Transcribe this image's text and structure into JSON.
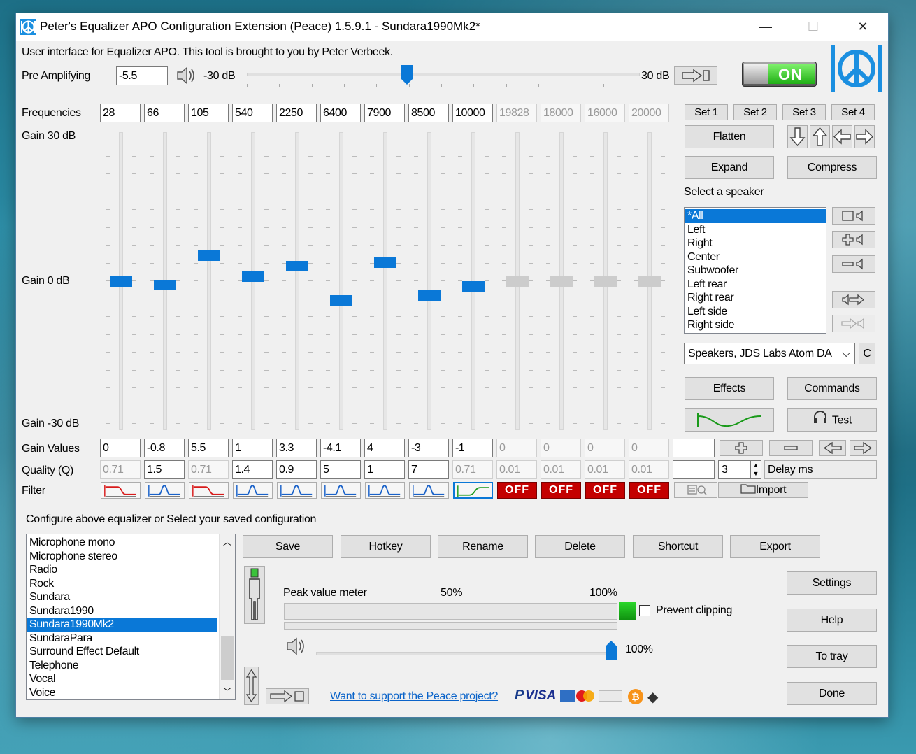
{
  "window": {
    "title": "Peter's Equalizer APO Configuration Extension (Peace) 1.5.9.1 - Sundara1990Mk2*",
    "minimize": "—",
    "maximize": "☐",
    "close": "✕"
  },
  "intro": "User interface for Equalizer APO. This tool is brought to you by Peter Verbeek.",
  "preamp": {
    "label": "Pre Amplifying",
    "value": "-5.5",
    "min_label": "-30 dB",
    "max_label": "30 dB",
    "level_db": -5.5
  },
  "power": {
    "label": "ON"
  },
  "labels": {
    "frequencies": "Frequencies",
    "gain_top": "Gain 30 dB",
    "gain_mid": "Gain 0 dB",
    "gain_bottom": "Gain -30 dB",
    "gain_values": "Gain Values",
    "quality": "Quality (Q)",
    "filter": "Filter",
    "select_speaker": "Select a speaker",
    "configure": "Configure above equalizer or Select your saved configuration",
    "peak_meter": "Peak value meter",
    "p50": "50%",
    "p100": "100%",
    "prevent_clipping": "Prevent clipping",
    "volume_pct": "100%",
    "delay_ms": "Delay ms",
    "delay_value": "3",
    "support_link": "Want to support the Peace project?"
  },
  "bands": [
    {
      "freq": "28",
      "gain": "0",
      "q": "0.71",
      "gain_db": 0,
      "enabled": true,
      "filter": "lowshelf"
    },
    {
      "freq": "66",
      "gain": "-0.8",
      "q": "1.5",
      "gain_db": -0.8,
      "enabled": true,
      "filter": "peak"
    },
    {
      "freq": "105",
      "gain": "5.5",
      "q": "0.71",
      "gain_db": 5.5,
      "enabled": true,
      "filter": "lowshelf"
    },
    {
      "freq": "540",
      "gain": "1",
      "q": "1.4",
      "gain_db": 1,
      "enabled": true,
      "filter": "peak"
    },
    {
      "freq": "2250",
      "gain": "3.3",
      "q": "0.9",
      "gain_db": 3.3,
      "enabled": true,
      "filter": "peak"
    },
    {
      "freq": "6400",
      "gain": "-4.1",
      "q": "5",
      "gain_db": -4.1,
      "enabled": true,
      "filter": "peak"
    },
    {
      "freq": "7900",
      "gain": "4",
      "q": "1",
      "gain_db": 4,
      "enabled": true,
      "filter": "peak"
    },
    {
      "freq": "8500",
      "gain": "-3",
      "q": "7",
      "gain_db": -3,
      "enabled": true,
      "filter": "peak"
    },
    {
      "freq": "10000",
      "gain": "-1",
      "q": "0.71",
      "gain_db": -1,
      "enabled": true,
      "filter": "highshelf"
    },
    {
      "freq": "19828",
      "gain": "0",
      "q": "0.01",
      "gain_db": 0,
      "enabled": false,
      "filter": "off"
    },
    {
      "freq": "18000",
      "gain": "0",
      "q": "0.01",
      "gain_db": 0,
      "enabled": false,
      "filter": "off"
    },
    {
      "freq": "16000",
      "gain": "0",
      "q": "0.01",
      "gain_db": 0,
      "enabled": false,
      "filter": "off"
    },
    {
      "freq": "20000",
      "gain": "0",
      "q": "0.01",
      "gain_db": 0,
      "enabled": false,
      "filter": "off"
    }
  ],
  "off_label": "OFF",
  "sets": [
    "Set 1",
    "Set 2",
    "Set 3",
    "Set 4"
  ],
  "buttons": {
    "flatten": "Flatten",
    "expand": "Expand",
    "compress": "Compress",
    "effects": "Effects",
    "commands": "Commands",
    "test": "Test",
    "import": "Import",
    "device_c": "C",
    "save": "Save",
    "hotkey": "Hotkey",
    "rename": "Rename",
    "delete": "Delete",
    "shortcut": "Shortcut",
    "export": "Export",
    "settings": "Settings",
    "help": "Help",
    "to_tray": "To tray",
    "done": "Done"
  },
  "speakers": [
    "*All",
    "Left",
    "Right",
    "Center",
    "Subwoofer",
    "Left rear",
    "Right rear",
    "Left side",
    "Right side"
  ],
  "device": "Speakers, JDS Labs Atom DA",
  "configs": [
    "Microphone mono",
    "Microphone stereo",
    "Radio",
    "Rock",
    "Sundara",
    "Sundara1990",
    "Sundara1990Mk2",
    "SundaraPara",
    "Surround Effect Default",
    "Telephone",
    "Vocal",
    "Voice"
  ],
  "selected_config": "Sundara1990Mk2",
  "payment": {
    "paypal": "P",
    "visa": "VISA"
  },
  "colors": {
    "accent": "#0a78d7",
    "off_red": "#c40000",
    "on_green": "#22c21a"
  }
}
